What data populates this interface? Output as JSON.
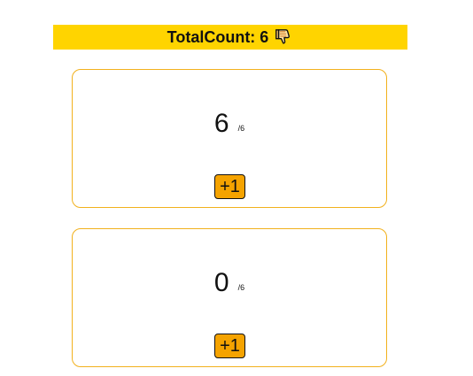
{
  "header": {
    "total_label": "TotalCount: 6",
    "icon": "thumbs-down-icon",
    "background_color": "#ffd400"
  },
  "counters": [
    {
      "value": "6",
      "max": "/6",
      "button_label": "+1"
    },
    {
      "value": "0",
      "max": "/6",
      "button_label": "+1"
    }
  ],
  "colors": {
    "card_border": "#f2b11d",
    "button_background": "#f5a300"
  }
}
